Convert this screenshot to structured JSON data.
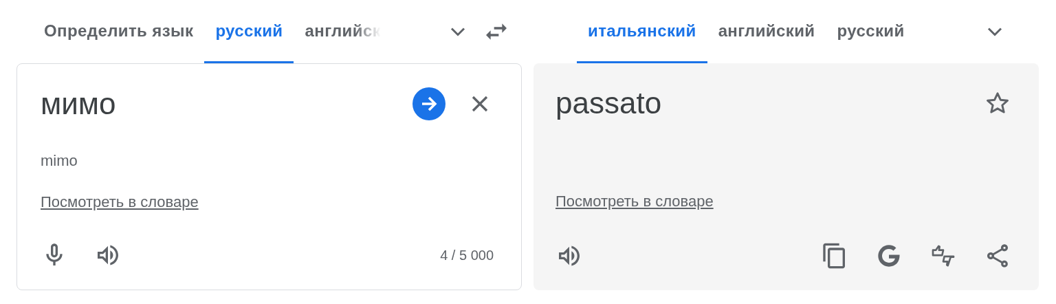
{
  "source_tabs": [
    {
      "label": "Определить язык",
      "selected": false,
      "faded": false
    },
    {
      "label": "русский",
      "selected": true,
      "faded": false
    },
    {
      "label": "английск",
      "selected": false,
      "faded": true
    }
  ],
  "target_tabs": [
    {
      "label": "итальянский",
      "selected": true,
      "faded": false
    },
    {
      "label": "английский",
      "selected": false,
      "faded": false
    },
    {
      "label": "русский",
      "selected": false,
      "faded": false
    }
  ],
  "source": {
    "text": "мимо",
    "transliteration": "mimo",
    "dictionary_link": "Посмотреть в словаре",
    "char_count": "4 / 5 000"
  },
  "target": {
    "text": "passato",
    "saved": false,
    "dictionary_link": "Посмотреть в словаре"
  }
}
